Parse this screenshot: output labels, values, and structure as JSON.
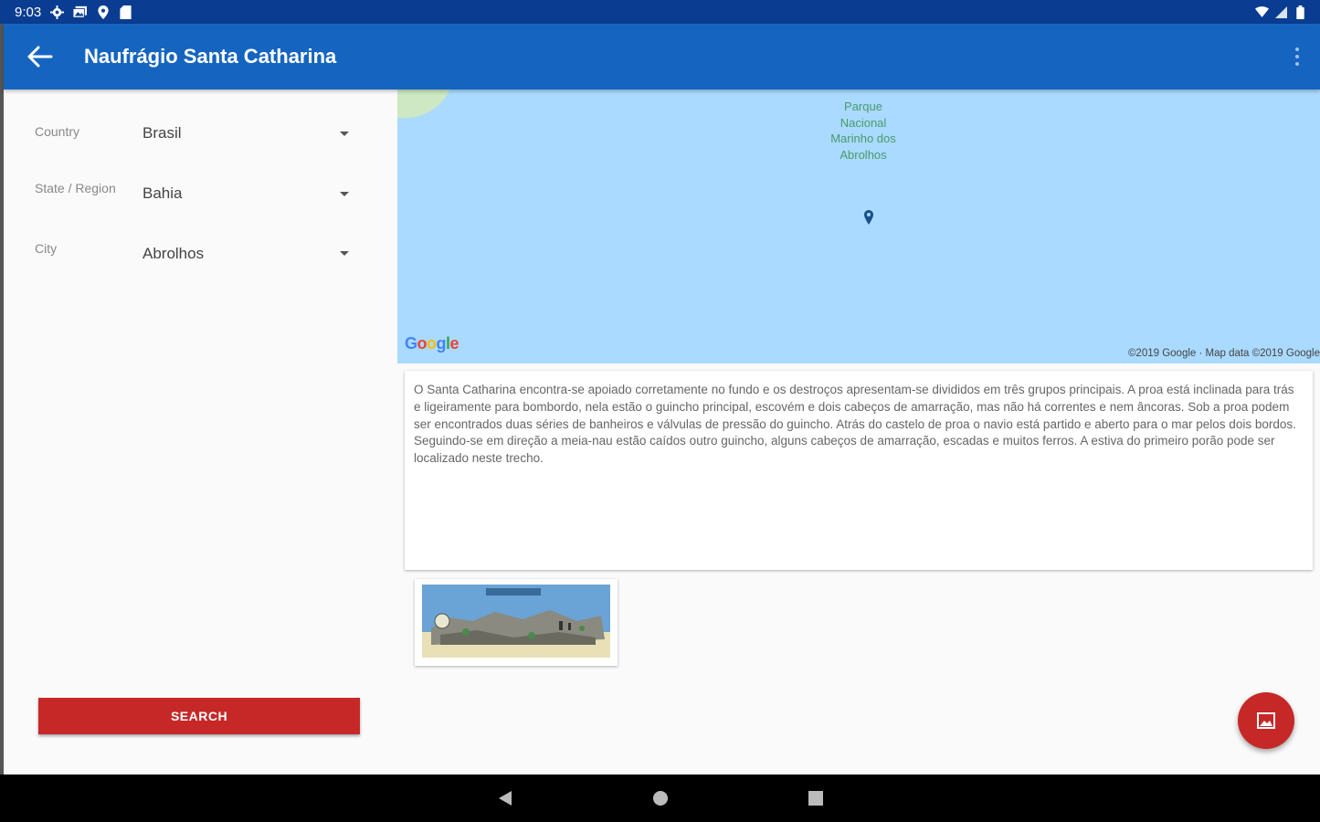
{
  "status_bar": {
    "time": "9:03",
    "icons": [
      "settings-icon",
      "gallery-icon",
      "location-icon",
      "sd-card-icon",
      "wifi-icon",
      "signal-icon",
      "battery-icon"
    ]
  },
  "app_bar": {
    "title": "Naufrágio Santa Catharina",
    "back_icon": "arrow-back-icon",
    "menu_icon": "more-vert-icon"
  },
  "filters": [
    {
      "label": "Country",
      "value": "Brasil"
    },
    {
      "label": "State / Region",
      "value": "Bahia"
    },
    {
      "label": "City",
      "value": "Abrolhos"
    }
  ],
  "search_button": {
    "label": "SEARCH"
  },
  "map": {
    "park_label": [
      "Parque",
      "Nacional",
      "Marinho dos",
      "Abrolhos"
    ],
    "provider": "Google",
    "copyright": "©2019 Google · Map data ©2019 Google"
  },
  "description": "O Santa Catharina encontra-se apoiado corretamente no fundo e os destroços apresentam-se divididos em três grupos principais. A proa está inclinada para trás e ligeiramente para bombordo, nela estão o guincho principal, escovém e dois cabeços de amarração, mas não há correntes e nem âncoras. Sob a proa podem ser encontrados duas séries de banheiros e válvulas de pressão do guincho. Atrás do castelo de proa o navio está partido e aberto para o mar pelos dois bordos. Seguindo-se em direção a meia-nau estão caídos outro guincho, alguns cabeços de amarração, escadas e muitos ferros. A estiva do primeiro porão pode ser localizado neste trecho.",
  "fab": {
    "icon": "image-icon"
  },
  "colors": {
    "app_bar": "#1565c0",
    "status_bar": "#0a3d91",
    "accent": "#c62828",
    "map_water": "#aadaff"
  }
}
